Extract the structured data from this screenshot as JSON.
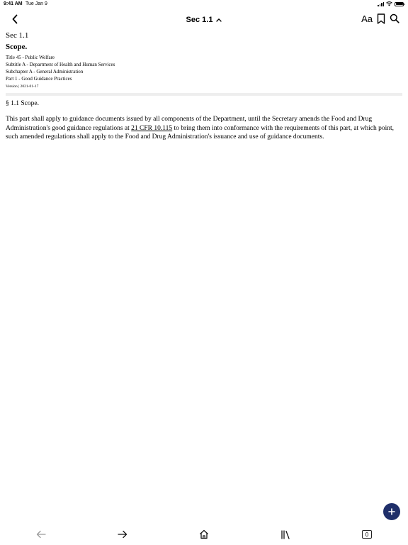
{
  "status_bar": {
    "time": "9:41 AM",
    "date": "Tue Jan 9",
    "icons": [
      "cellular-signal-icon",
      "wifi-icon",
      "battery-icon"
    ]
  },
  "nav": {
    "title": "Sec 1.1",
    "font_button_label": "Aa",
    "icons": [
      "back-chevron-icon",
      "chevron-up-icon",
      "bookmark-icon",
      "search-icon"
    ]
  },
  "document": {
    "section_number": "Sec 1.1",
    "section_heading": "Scope.",
    "breadcrumbs": [
      "Title 45 - Public Welfare",
      "Subtitle A - Department of Health and Human Services",
      "Subchapter A - General Administration",
      "Part 1 - Good Guidance Practices"
    ],
    "version": "Version | 2021-01-17",
    "body_heading": "§ 1.1 Scope.",
    "paragraph_before_link": "This part shall apply to guidance documents issued by all components of the Department, until the Secretary amends the Food and Drug Administration's good guidance regulations at ",
    "link_text": "21 CFR 10.115",
    "paragraph_after_link": " to bring them into conformance with the requirements of this part, at which point, such amended regulations shall apply to the Food and Drug Administration's issuance and use of guidance documents."
  },
  "fab": {
    "icon": "plus-icon"
  },
  "toolbar": {
    "icons": [
      "arrow-left-icon",
      "arrow-right-icon",
      "home-icon",
      "library-icon",
      "tabs-icon"
    ],
    "tabs_count": "0"
  },
  "colors": {
    "fab_background": "#1f2f6a",
    "disabled_icon": "#9a9a9a",
    "divider": "#eeeeee"
  }
}
